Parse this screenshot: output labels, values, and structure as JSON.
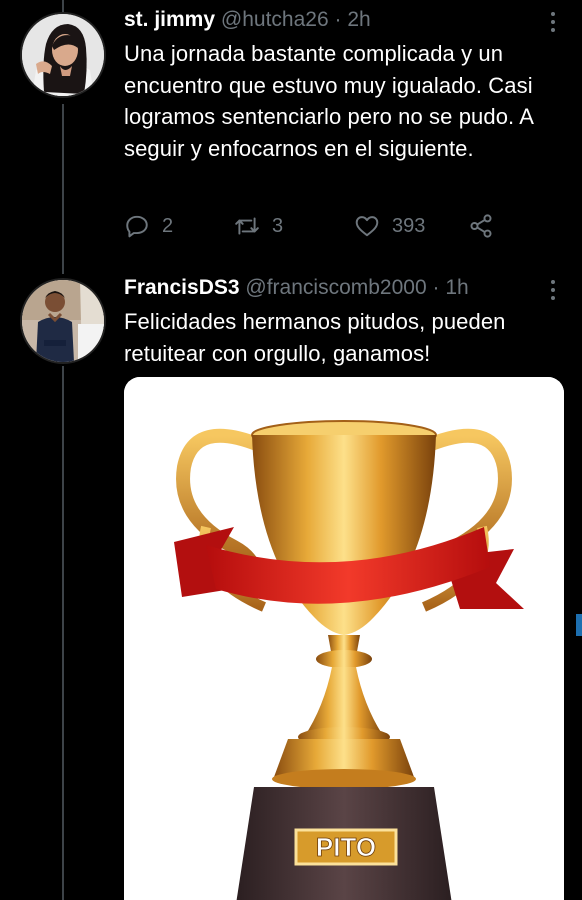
{
  "tweets": [
    {
      "display_name": "st. jimmy",
      "handle": "@hutcha26",
      "separator": "·",
      "time": "2h",
      "text": "Una jornada bastante complicada y un encuentro que estuvo muy igualado. Casi logramos sentenciarlo pero no se pudo. A seguir y enfocarnos en el siguiente.",
      "replies": "2",
      "retweets": "3",
      "likes": "393"
    },
    {
      "display_name": "FrancisDS3",
      "handle": "@franciscomb2000",
      "separator": "·",
      "time": "1h",
      "text": "Felicidades hermanos pitudos, pueden retuitear con orgullo, ganamos!",
      "image_caption": "PITO"
    }
  ],
  "icons": {
    "reply": "reply-icon",
    "retweet": "retweet-icon",
    "like": "heart-icon",
    "share": "share-icon",
    "more": "more-icon"
  },
  "colors": {
    "background": "#000000",
    "muted": "#6e767d",
    "text": "#ffffff",
    "trophy_gold": "#d89a2a",
    "ribbon_red": "#e02020"
  }
}
